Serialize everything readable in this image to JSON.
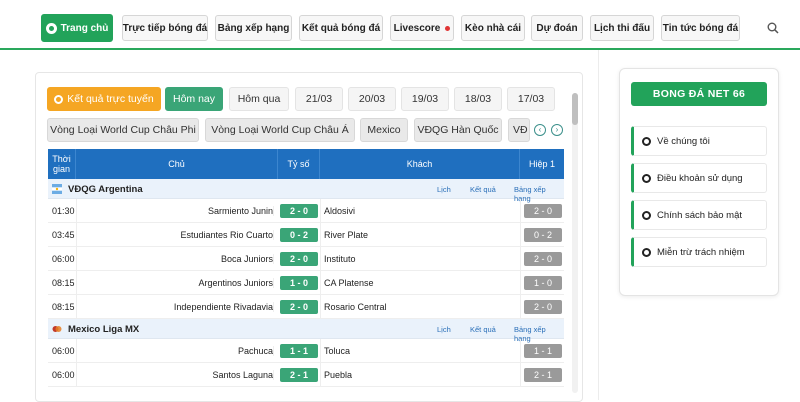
{
  "nav": {
    "items": [
      {
        "label": "Trang chủ",
        "active": true
      },
      {
        "label": "Trực tiếp bóng đá"
      },
      {
        "label": "Bảng xếp hạng"
      },
      {
        "label": "Kết quả bóng đá"
      },
      {
        "label": "Livescore"
      },
      {
        "label": "Kèo nhà cái"
      },
      {
        "label": "Dự đoán"
      },
      {
        "label": "Lịch thi đấu"
      },
      {
        "label": "Tin tức bóng đá"
      }
    ]
  },
  "dates": {
    "live": "Kết quả trực tuyến",
    "today": "Hôm nay",
    "yesterday": "Hôm qua",
    "d1": "21/03",
    "d2": "20/03",
    "d3": "19/03",
    "d4": "18/03",
    "d5": "17/03"
  },
  "leagues_tabs": [
    "Vòng Loại World Cup Châu Phi",
    "Vòng Loại World Cup Châu Á",
    "Mexico",
    "VĐQG Hàn Quốc",
    "VĐ"
  ],
  "table": {
    "headers": {
      "time": "Thời gian",
      "home": "Chủ",
      "score": "Tỷ số",
      "away": "Khách",
      "half": "Hiệp 1"
    },
    "links": {
      "schedule": "Lịch",
      "result": "Kết quả",
      "standings": "Bảng xếp hạng"
    },
    "groups": [
      {
        "league": "VĐQG Argentina",
        "matches": [
          {
            "time": "01:30",
            "home": "Sarmiento Junin",
            "score": "2 - 0",
            "away": "Aldosivi",
            "half": "2 - 0"
          },
          {
            "time": "03:45",
            "home": "Estudiantes Rio Cuarto",
            "score": "0 - 2",
            "away": "River Plate",
            "half": "0 - 2"
          },
          {
            "time": "06:00",
            "home": "Boca Juniors",
            "score": "2 - 0",
            "away": "Instituto",
            "half": "2 - 0"
          },
          {
            "time": "08:15",
            "home": "Argentinos Juniors",
            "score": "1 - 0",
            "away": "CA Platense",
            "half": "1 - 0"
          },
          {
            "time": "08:15",
            "home": "Independiente Rivadavia",
            "score": "2 - 0",
            "away": "Rosario Central",
            "half": "2 - 0"
          }
        ]
      },
      {
        "league": "Mexico Liga MX",
        "matches": [
          {
            "time": "06:00",
            "home": "Pachuca",
            "score": "1 - 1",
            "away": "Toluca",
            "half": "1 - 1"
          },
          {
            "time": "06:00",
            "home": "Santos Laguna",
            "score": "2 - 1",
            "away": "Puebla",
            "half": "2 - 1"
          }
        ]
      }
    ]
  },
  "sidebar": {
    "brand": "BONG ĐÁ NET 66",
    "items": [
      "Về chúng tôi",
      "Điều khoản sử dụng",
      "Chính sách bảo mật",
      "Miễn trừ trách nhiệm"
    ]
  },
  "colors": {
    "accent": "#22a35a",
    "header_blue": "#1f6fbf",
    "live_orange": "#f5a623"
  }
}
